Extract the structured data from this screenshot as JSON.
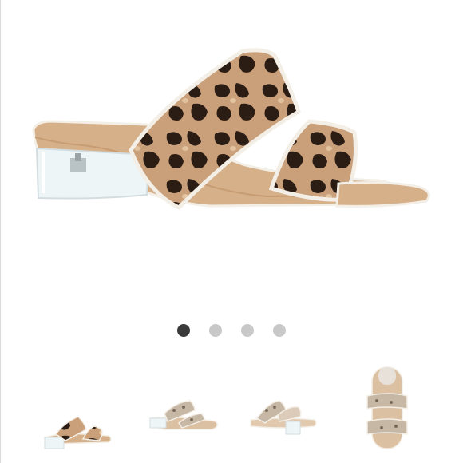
{
  "product_image": {
    "name": "leopard-print-two-strap-slide-sandal",
    "colors": {
      "leopard_base": "#c9a07a",
      "leopard_spot": "#2b1c14",
      "insole": "#d6b089",
      "piping": "#f3eee6",
      "heel": "#e8f0f2"
    }
  },
  "carousel": {
    "current_index": 1,
    "total": 4
  },
  "thumbnails": [
    {
      "name": "side-view",
      "pattern": "leopard"
    },
    {
      "name": "angled-view",
      "pattern": "snake"
    },
    {
      "name": "back-view",
      "pattern": "snake"
    },
    {
      "name": "top-view",
      "pattern": "snake"
    }
  ]
}
